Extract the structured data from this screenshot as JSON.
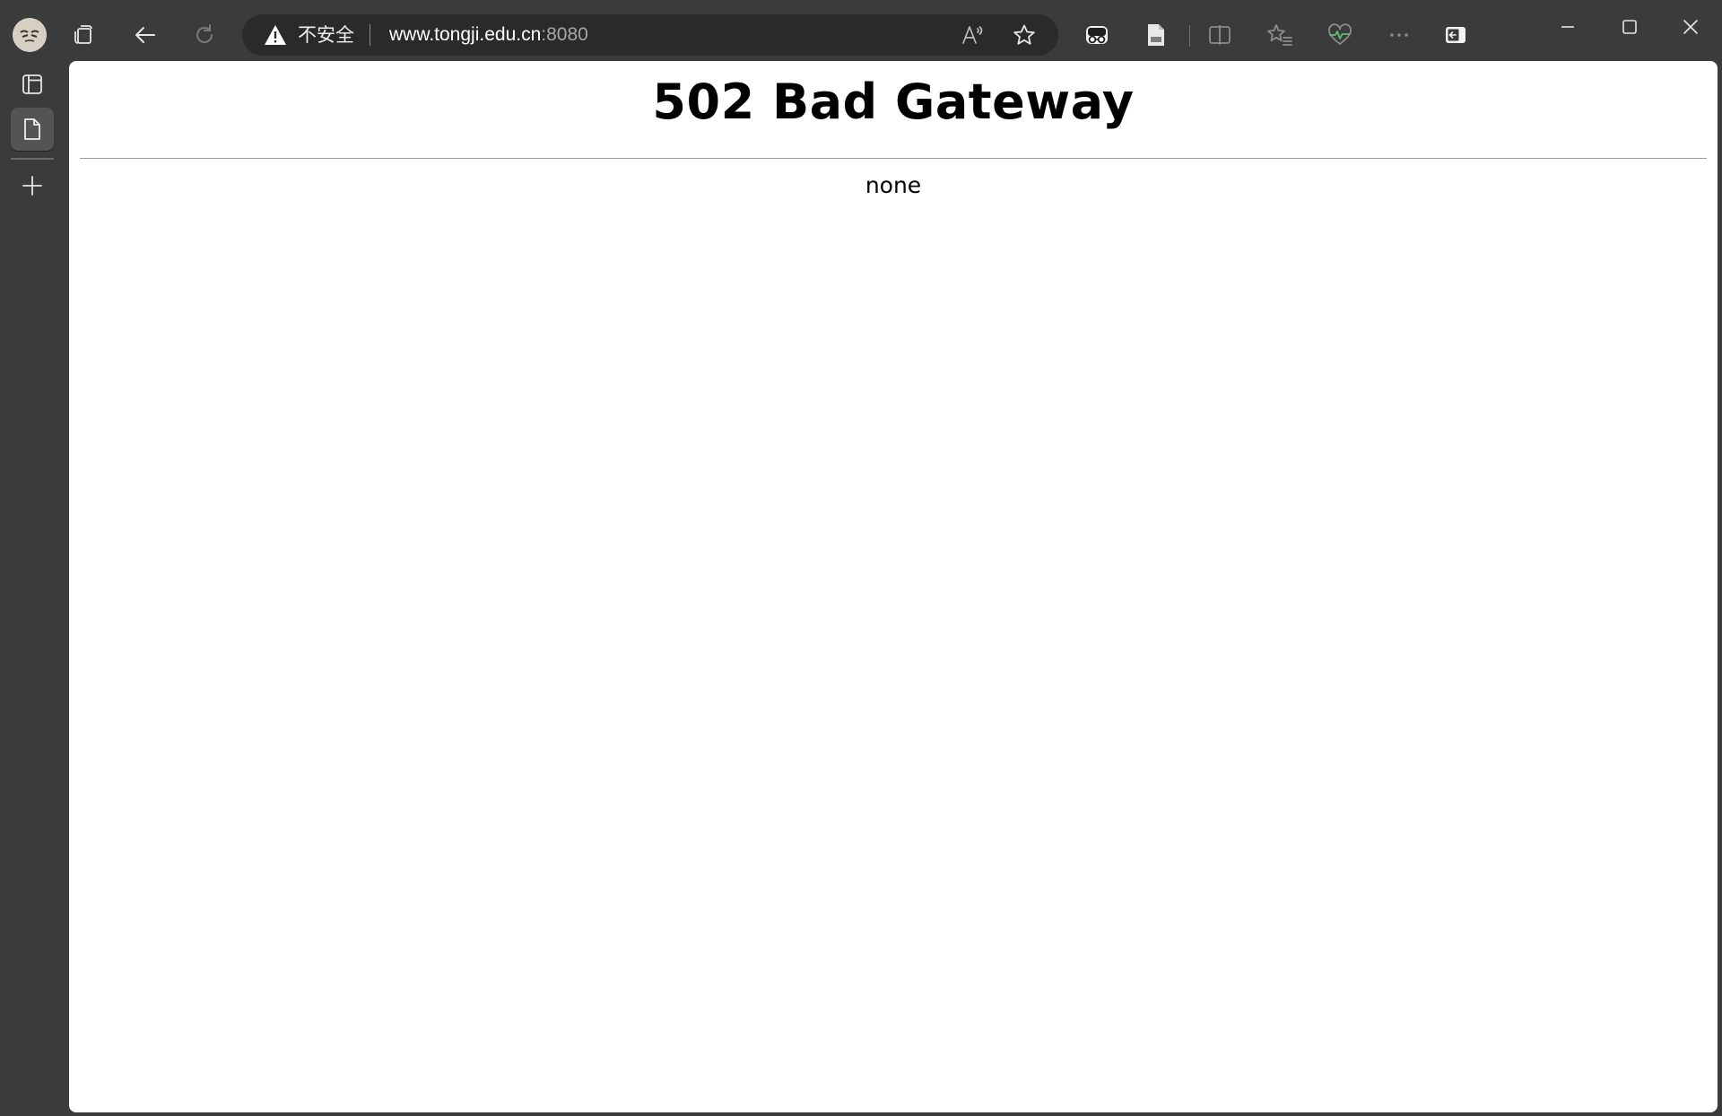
{
  "browser": {
    "toolbar": {
      "profile_icon": "profile-avatar",
      "workspaces_icon": "tab-actions-icon",
      "back_icon": "back-arrow-icon",
      "refresh_icon": "refresh-icon"
    },
    "address_bar": {
      "security_icon": "warning-triangle-icon",
      "security_label": "不安全",
      "url_host": "www.tongji.edu.cn",
      "url_port": ":8080",
      "read_aloud_icon": "read-aloud-icon",
      "favorite_icon": "star-icon"
    },
    "extensions": [
      "incognito-extension-icon",
      "document-extension-icon"
    ],
    "right_actions": [
      "split-screen-icon",
      "favorites-icon",
      "browser-essentials-icon",
      "more-icon",
      "sidebar-toggle-icon"
    ],
    "window_controls": [
      "minimize-icon",
      "maximize-icon",
      "close-icon"
    ]
  },
  "sidebar": {
    "items": [
      {
        "icon": "vertical-tabs-icon",
        "active": false
      },
      {
        "icon": "page-tab-icon",
        "active": true
      },
      {
        "icon": "new-tab-plus-icon",
        "active": false
      }
    ]
  },
  "page": {
    "heading": "502 Bad Gateway",
    "body_text": "none"
  },
  "colors": {
    "chrome_background": "#3b3b3b",
    "address_bar_background": "#2a2a2a",
    "page_background": "#ffffff",
    "port_text": "#a6a6a6"
  }
}
